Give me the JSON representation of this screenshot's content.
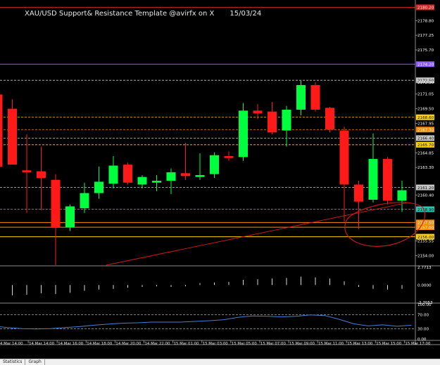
{
  "window": {
    "title": "XAU/USD Support& Resistance Template @avirfx on X",
    "date": "15/03/24"
  },
  "colors": {
    "background": "#000000",
    "bull": "#00ff3c",
    "bear": "#ff1a1a",
    "axis_text": "#ffffff",
    "grid": "#c8c8c8",
    "trendline": "#d81818",
    "circle": "#d81818",
    "rsi_line": "#4a7fd0",
    "histogram": "#d9d9d9",
    "separator": "#8a8a8a"
  },
  "chart_data": {
    "type": "candlestick",
    "symbol": "XAU/USD",
    "x_labels": [
      "4 Mar 14:00",
      "14 Mar 14:00",
      "14 Mar 16:00",
      "14 Mar 18:00",
      "14 Mar 20:00",
      "14 Mar 22:00",
      "15 Mar 01:00",
      "15 Mar 03:00",
      "15 Mar 05:00",
      "15 Mar 07:00",
      "15 Mar 09:00",
      "15 Mar 11:00",
      "15 Mar 13:00",
      "15 Mar 15:00",
      "15 Mar 17:00"
    ],
    "ylim": [
      2153.0,
      2180.6
    ],
    "y_ticks": [
      "2178.80",
      "2177.25",
      "2175.70",
      "2172.30",
      "2171.05",
      "2169.50",
      "2167.95",
      "2164.85",
      "2163.30",
      "2160.40",
      "2155.55",
      "2154.00"
    ],
    "price_levels": [
      {
        "price": 2180.2,
        "label": "2180.20",
        "kind": "resistance",
        "color": "#e02020"
      },
      {
        "price": 2174.2,
        "label": "2174.20",
        "kind": "resistance",
        "color": "#8a5cff"
      },
      {
        "price": 2172.5,
        "label": "2172.50",
        "kind": "level",
        "color": "#c8c8c8"
      },
      {
        "price": 2168.6,
        "label": "2168.60",
        "kind": "level",
        "color": "#ffd400"
      },
      {
        "price": 2167.3,
        "label": "2167.30",
        "kind": "level",
        "color": "#ff8c00"
      },
      {
        "price": 2166.4,
        "label": "2166.40",
        "kind": "level",
        "color": "#c8c8c8"
      },
      {
        "price": 2165.7,
        "label": "2165.70",
        "kind": "level",
        "color": "#ffd400"
      },
      {
        "price": 2161.2,
        "label": "2161.20",
        "kind": "level",
        "color": "#c8c8c8"
      },
      {
        "price": 2158.9,
        "label": "2158.90",
        "kind": "current",
        "color": "#2ec4b6"
      },
      {
        "price": 2157.5,
        "label": "2157.50",
        "kind": "support",
        "color": "#ff8c00"
      },
      {
        "price": 2157.0,
        "label": "2157.00",
        "kind": "support",
        "color": "#ff8c00"
      },
      {
        "price": 2156.0,
        "label": "2156.00",
        "kind": "support",
        "color": "#ffd400"
      }
    ],
    "candles": [
      {
        "o": 2171.0,
        "h": 2171.5,
        "l": 2163.4,
        "c": 2163.4
      },
      {
        "o": 2169.5,
        "h": 2170.5,
        "l": 2163.6,
        "c": 2163.6
      },
      {
        "o": 2163.0,
        "h": 2166.8,
        "l": 2158.5,
        "c": 2162.8
      },
      {
        "o": 2162.9,
        "h": 2165.5,
        "l": 2158.8,
        "c": 2162.2
      },
      {
        "o": 2162.0,
        "h": 2162.6,
        "l": 2153.0,
        "c": 2157.0
      },
      {
        "o": 2157.0,
        "h": 2159.4,
        "l": 2156.6,
        "c": 2159.2
      },
      {
        "o": 2159.0,
        "h": 2161.7,
        "l": 2158.5,
        "c": 2160.6
      },
      {
        "o": 2160.6,
        "h": 2163.4,
        "l": 2160.0,
        "c": 2161.8
      },
      {
        "o": 2161.6,
        "h": 2164.5,
        "l": 2161.1,
        "c": 2163.5
      },
      {
        "o": 2163.6,
        "h": 2163.8,
        "l": 2161.5,
        "c": 2161.7
      },
      {
        "o": 2161.5,
        "h": 2162.5,
        "l": 2161.1,
        "c": 2162.3
      },
      {
        "o": 2161.7,
        "h": 2162.5,
        "l": 2160.8,
        "c": 2161.9
      },
      {
        "o": 2161.9,
        "h": 2163.2,
        "l": 2160.5,
        "c": 2162.8
      },
      {
        "o": 2162.7,
        "h": 2165.9,
        "l": 2162.0,
        "c": 2162.4
      },
      {
        "o": 2162.3,
        "h": 2164.8,
        "l": 2162.0,
        "c": 2162.5
      },
      {
        "o": 2162.6,
        "h": 2164.9,
        "l": 2162.2,
        "c": 2164.6
      },
      {
        "o": 2164.5,
        "h": 2165.0,
        "l": 2164.0,
        "c": 2164.3
      },
      {
        "o": 2164.4,
        "h": 2170.1,
        "l": 2164.0,
        "c": 2169.3
      },
      {
        "o": 2169.3,
        "h": 2170.0,
        "l": 2168.4,
        "c": 2169.0
      },
      {
        "o": 2169.2,
        "h": 2170.2,
        "l": 2166.8,
        "c": 2167.0
      },
      {
        "o": 2167.2,
        "h": 2169.8,
        "l": 2165.5,
        "c": 2169.4
      },
      {
        "o": 2169.4,
        "h": 2172.5,
        "l": 2168.8,
        "c": 2172.0
      },
      {
        "o": 2172.0,
        "h": 2172.3,
        "l": 2169.2,
        "c": 2169.4
      },
      {
        "o": 2169.6,
        "h": 2169.7,
        "l": 2167.0,
        "c": 2167.3
      },
      {
        "o": 2167.2,
        "h": 2167.6,
        "l": 2157.6,
        "c": 2161.5
      },
      {
        "o": 2161.5,
        "h": 2161.9,
        "l": 2156.8,
        "c": 2159.7
      },
      {
        "o": 2159.9,
        "h": 2166.9,
        "l": 2159.6,
        "c": 2164.2
      },
      {
        "o": 2164.2,
        "h": 2164.4,
        "l": 2159.4,
        "c": 2159.8
      },
      {
        "o": 2159.8,
        "h": 2161.9,
        "l": 2158.6,
        "c": 2160.9
      }
    ],
    "trendline": {
      "from_candle": 7.5,
      "from_price": 2153.0,
      "to_candle": 28.4,
      "to_price": 2159.6
    },
    "highlight_circle": {
      "center_candle": 26.5,
      "center_price": 2157.5
    },
    "histogram": {
      "ylim": [
        -2.7053,
        2.7713
      ],
      "y_ticks": [
        "2.7713",
        "0.0000",
        "-2.7053"
      ],
      "values": [
        -1.5,
        -1.6,
        -1.5,
        -1.3,
        -1.4,
        -1.2,
        -0.9,
        -0.7,
        -0.6,
        -0.4,
        -0.3,
        -0.2,
        -0.3,
        -0.2,
        0.3,
        0.4,
        0.5,
        0.8,
        0.9,
        1.0,
        1.1,
        1.3,
        1.2,
        1.0,
        0.6,
        -0.3,
        -0.6,
        -0.7,
        -0.6
      ]
    },
    "oscillator": {
      "ylim": [
        0,
        100
      ],
      "y_ticks": [
        "100.00",
        "70.00",
        "30.00",
        "0.00"
      ],
      "values": [
        38,
        33,
        30,
        29,
        30,
        33,
        36,
        40,
        43,
        46,
        47,
        49,
        49,
        49,
        51,
        53,
        56,
        63,
        67,
        66,
        64,
        66,
        70,
        68,
        57,
        44,
        38,
        41,
        37,
        40
      ]
    }
  },
  "status_tabs": [
    "Statistics",
    "Graph"
  ]
}
